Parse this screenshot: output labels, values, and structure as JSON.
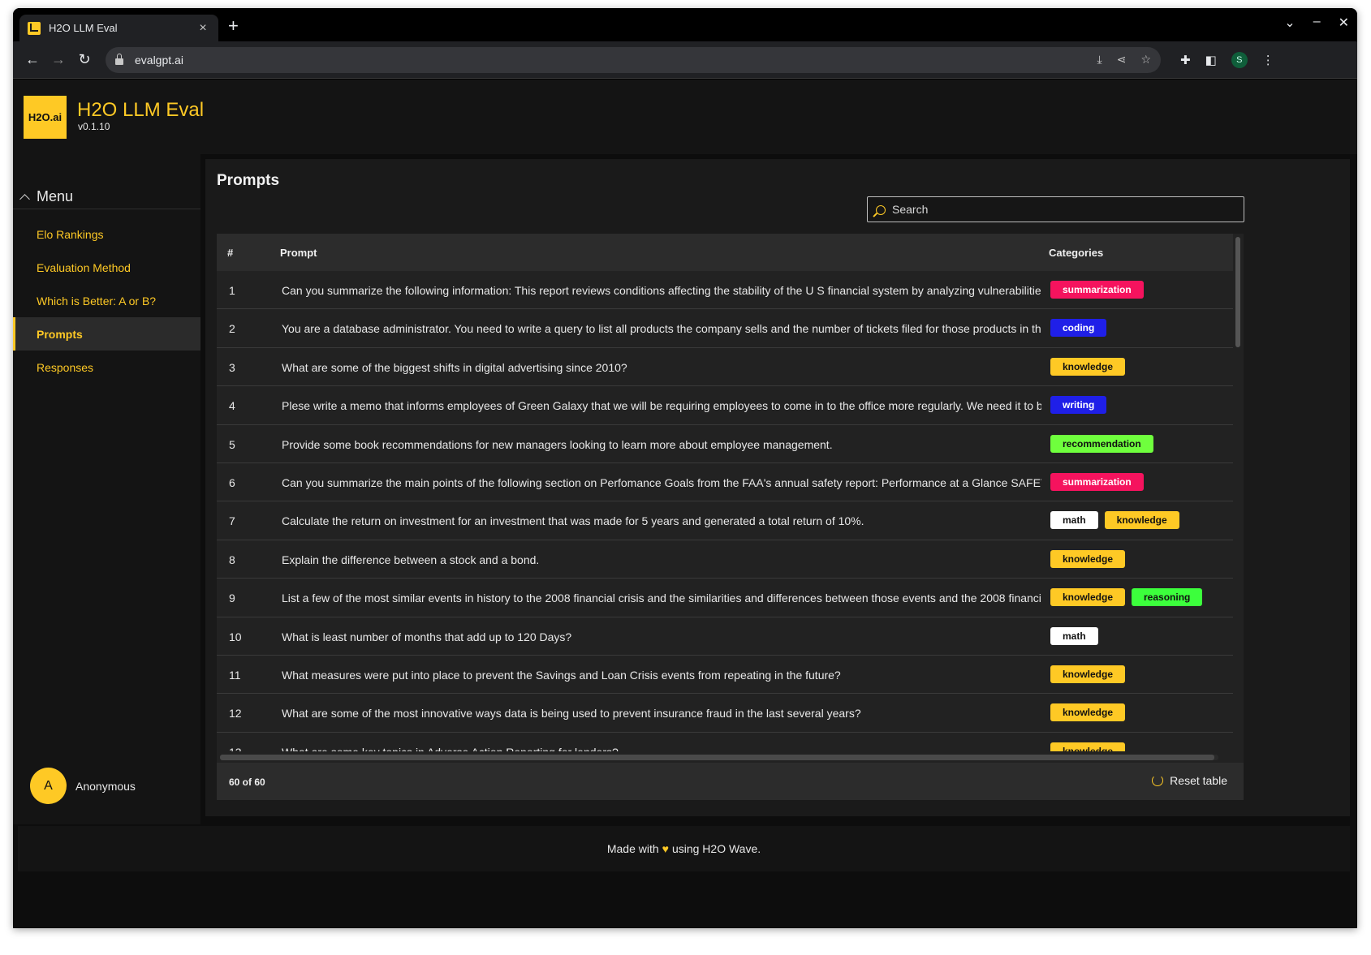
{
  "browser": {
    "tab_title": "H2O LLM Eval",
    "new_tab": "+",
    "url": "evalgpt.ai",
    "profile_initial": "S"
  },
  "app": {
    "logo_text": "H2O.ai",
    "title": "H2O LLM Eval",
    "version": "v0.1.10",
    "brand_color": "#fec925"
  },
  "sidebar": {
    "menu_label": "Menu",
    "items": [
      {
        "label": "Elo Rankings"
      },
      {
        "label": "Evaluation Method"
      },
      {
        "label": "Which is Better: A or B?"
      },
      {
        "label": "Prompts"
      },
      {
        "label": "Responses"
      }
    ],
    "active_index": 3,
    "user": {
      "initial": "A",
      "name": "Anonymous"
    }
  },
  "main": {
    "title": "Prompts",
    "search_placeholder": "Search",
    "table": {
      "columns": [
        "#",
        "Prompt",
        "Categories"
      ],
      "rows": [
        {
          "num": "1",
          "prompt": "Can you summarize the following information: This report reviews conditions affecting the stability of the U S financial system by analyzing vulnerabilities",
          "cats": [
            "summarization"
          ]
        },
        {
          "num": "2",
          "prompt": "You are a database administrator. You need to write a query to list all products the company sells and the number of tickets filed for those products in the",
          "cats": [
            "coding"
          ]
        },
        {
          "num": "3",
          "prompt": "What are some of the biggest shifts in digital advertising since 2010?",
          "cats": [
            "knowledge"
          ]
        },
        {
          "num": "4",
          "prompt": "Plese write a memo that informs employees of Green Galaxy that we will be requiring employees to come in to the office more regularly. We need it to be",
          "cats": [
            "writing"
          ]
        },
        {
          "num": "5",
          "prompt": "Provide some book recommendations for new managers looking to learn more about employee management.",
          "cats": [
            "recommendation"
          ]
        },
        {
          "num": "6",
          "prompt": "Can you summarize the main points of the following section on Perfomance Goals from the FAA's annual safety report: Performance at a Glance SAFETY",
          "cats": [
            "summarization"
          ]
        },
        {
          "num": "7",
          "prompt": "Calculate the return on investment for an investment that was made for 5 years and generated a total return of 10%.",
          "cats": [
            "math",
            "knowledge"
          ]
        },
        {
          "num": "8",
          "prompt": "Explain the difference between a stock and a bond.",
          "cats": [
            "knowledge"
          ]
        },
        {
          "num": "9",
          "prompt": "List a few of the most similar events in history to the 2008 financial crisis and the similarities and differences between those events and the 2008 financi",
          "cats": [
            "knowledge",
            "reasoning"
          ]
        },
        {
          "num": "10",
          "prompt": "What is least number of months that add up to 120 Days?",
          "cats": [
            "math"
          ]
        },
        {
          "num": "11",
          "prompt": "What measures were put into place to prevent the Savings and Loan Crisis events from repeating in the future?",
          "cats": [
            "knowledge"
          ]
        },
        {
          "num": "12",
          "prompt": "What are some of the most innovative ways data is being used to prevent insurance fraud in the last several years?",
          "cats": [
            "knowledge"
          ]
        },
        {
          "num": "13",
          "prompt": "What are some key topics in Adverse Action Reporting for lenders?",
          "cats": [
            "knowledge"
          ]
        }
      ],
      "count_label": "60 of 60",
      "reset_label": "Reset table"
    }
  },
  "footer": {
    "before": "Made with",
    "heart": "♥",
    "after": "using H2O Wave."
  }
}
